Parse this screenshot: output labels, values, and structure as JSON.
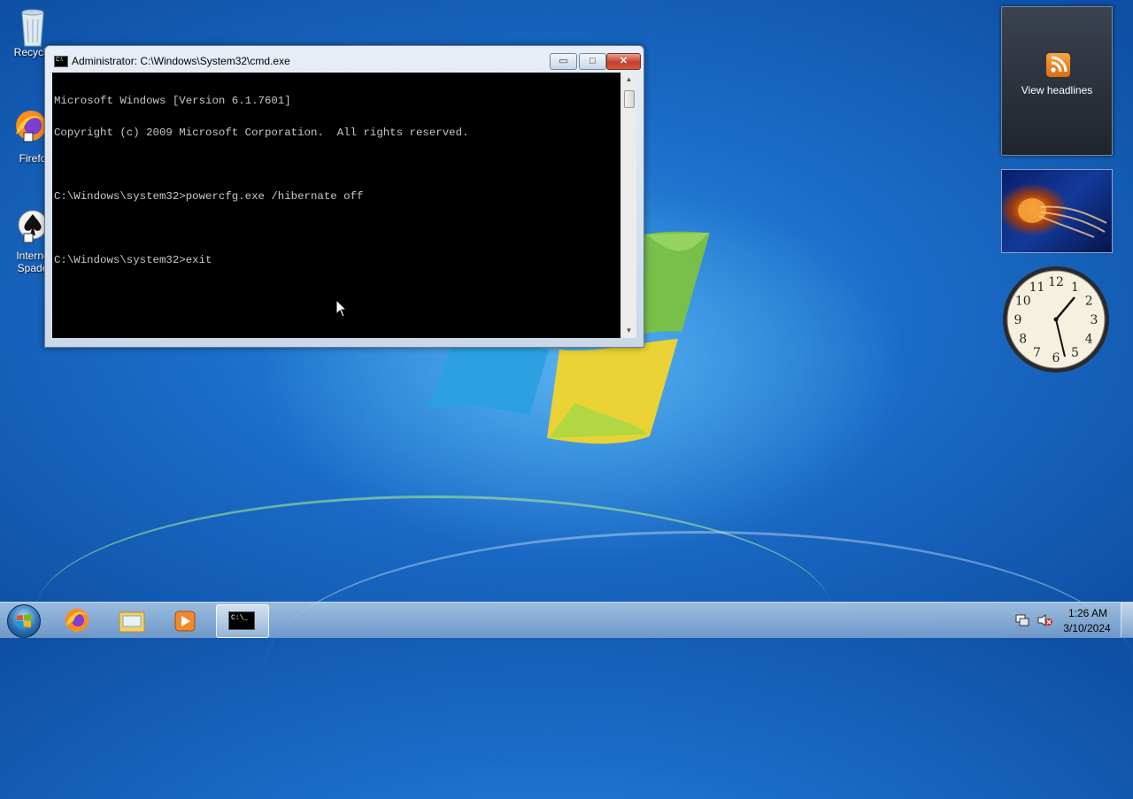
{
  "desktop": {
    "icons": [
      {
        "label": "Recycle"
      },
      {
        "label": "Firefo"
      },
      {
        "label": "Interne\nSpade"
      }
    ]
  },
  "cmd_window": {
    "title": "Administrator: C:\\Windows\\System32\\cmd.exe",
    "lines": [
      "Microsoft Windows [Version 6.1.7601]",
      "Copyright (c) 2009 Microsoft Corporation.  All rights reserved.",
      "",
      "C:\\Windows\\system32>powercfg.exe /hibernate off",
      "",
      "C:\\Windows\\system32>exit"
    ],
    "min_glyph": "▭",
    "max_glyph": "□",
    "close_glyph": "✕"
  },
  "gadgets": {
    "feed_label": "View headlines",
    "clock_numbers": [
      "12",
      "1",
      "2",
      "3",
      "4",
      "5",
      "6",
      "7",
      "8",
      "9",
      "10",
      "11"
    ]
  },
  "taskbar": {
    "time": "1:26 AM",
    "date": "3/10/2024",
    "cmd_icon_text": "C:\\_"
  },
  "colors": {
    "desktop_blue": "#1b6cc9",
    "console_bg": "#000000",
    "console_text": "#c8c8c8",
    "rss_orange": "#f28a2a"
  }
}
